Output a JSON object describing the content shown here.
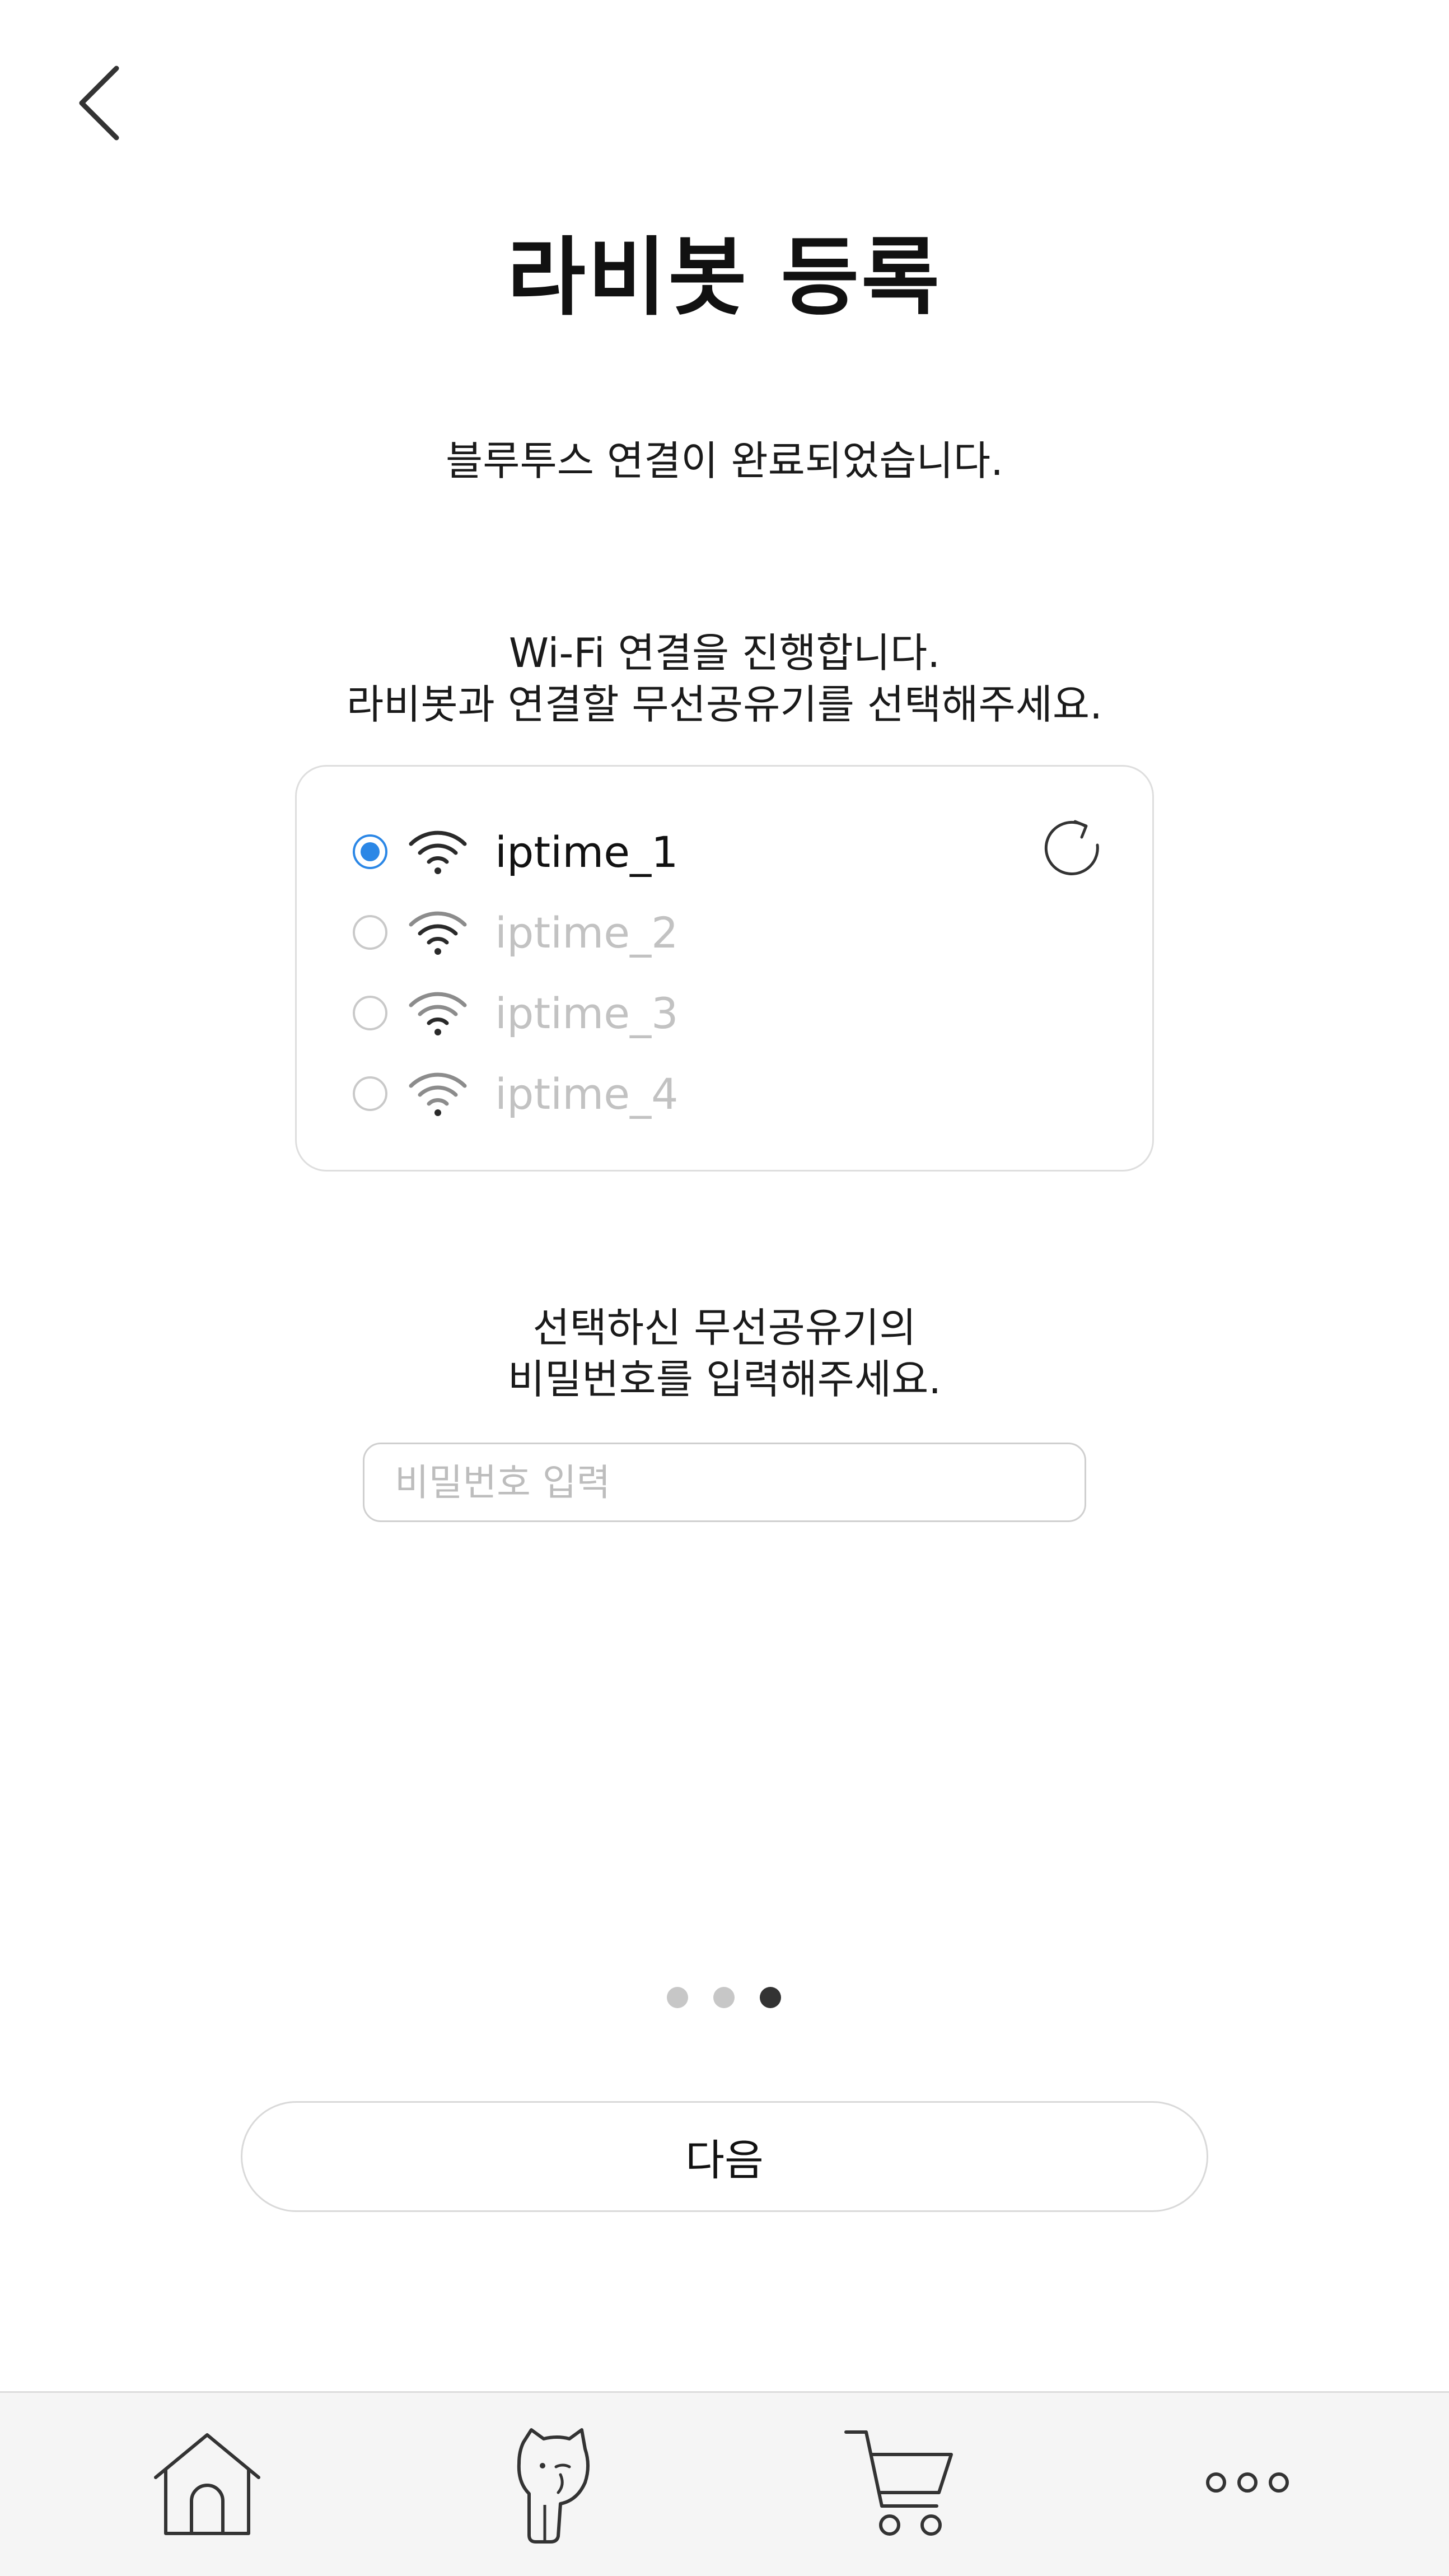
{
  "header": {
    "back_icon": "chevron-left-icon",
    "title": "라비봇 등록"
  },
  "status": {
    "bluetooth_message": "블루투스 연결이 완료되었습니다."
  },
  "wifi": {
    "instruction_line1": "Wi-Fi 연결을 진행합니다.",
    "instruction_line2": "라비봇과 연결할 무선공유기를 선택해주세요.",
    "refresh_icon": "refresh-icon",
    "networks": [
      {
        "ssid": "iptime_1",
        "selected": true
      },
      {
        "ssid": "iptime_2",
        "selected": false
      },
      {
        "ssid": "iptime_3",
        "selected": false
      },
      {
        "ssid": "iptime_4",
        "selected": false
      }
    ],
    "accent_color": "#2b87e6"
  },
  "password": {
    "instruction_line1": "선택하신 무선공유기의",
    "instruction_line2": "비밀번호를 입력해주세요.",
    "placeholder": "비밀번호 입력",
    "value": ""
  },
  "pagination": {
    "total": 3,
    "current": 3
  },
  "actions": {
    "next_label": "다음"
  },
  "bottom_nav": {
    "items": [
      {
        "icon": "home-icon"
      },
      {
        "icon": "cat-icon"
      },
      {
        "icon": "cart-icon"
      },
      {
        "icon": "more-icon"
      }
    ]
  }
}
